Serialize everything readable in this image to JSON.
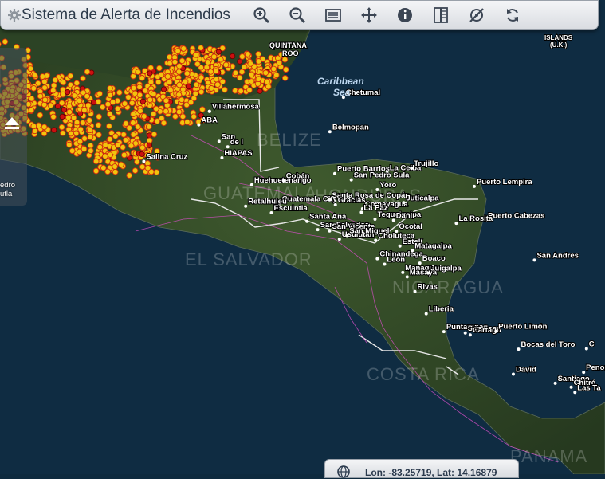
{
  "app": {
    "title": "Sistema de Alerta de Incendios"
  },
  "toolbar": {
    "buttons": [
      {
        "name": "zoom-in-button",
        "icon": "zoom-in-icon"
      },
      {
        "name": "zoom-out-button",
        "icon": "zoom-out-icon"
      },
      {
        "name": "layers-list-button",
        "icon": "list-icon"
      },
      {
        "name": "pan-button",
        "icon": "move-icon"
      },
      {
        "name": "info-button",
        "icon": "info-icon"
      },
      {
        "name": "swipe-button",
        "icon": "swipe-icon"
      },
      {
        "name": "measure-button",
        "icon": "measure-icon"
      },
      {
        "name": "refresh-button",
        "icon": "refresh-icon"
      }
    ]
  },
  "sidepanel": {
    "fragment_line1": "edro",
    "fragment_line2": "utla"
  },
  "coords": {
    "text": "Lon: -83.25719, Lat: 14.16879"
  },
  "map": {
    "sea_labels": [
      "Caribbean",
      "Sea"
    ],
    "country_labels": [
      "BELIZE",
      "HONDURAS",
      "EL SALVADOR",
      "NICARAGUA",
      "COSTA RICA",
      "PANAMA",
      "GUATEMALA"
    ],
    "top_labels": [
      "QUINTANA",
      "ROO",
      "ISLANDS",
      "(U.K.)"
    ],
    "cities": [
      {
        "name": "Chetumal",
        "lon": -88.3,
        "lat": 18.5
      },
      {
        "name": "Villahermosa",
        "lon": -92.93,
        "lat": 17.99
      },
      {
        "name": "Belmopan",
        "lon": -88.77,
        "lat": 17.25
      },
      {
        "name": "Salina Cruz",
        "lon": -95.2,
        "lat": 16.17
      },
      {
        "name": "Huehuetenango",
        "lon": -91.47,
        "lat": 15.32
      },
      {
        "name": "Cobán",
        "lon": -90.37,
        "lat": 15.47
      },
      {
        "name": "Guatemala City",
        "lon": -90.51,
        "lat": 14.63
      },
      {
        "name": "Retalhuleu",
        "lon": -91.68,
        "lat": 14.54
      },
      {
        "name": "Escuintla",
        "lon": -90.79,
        "lat": 14.3
      },
      {
        "name": "Puerto Barrios",
        "lon": -88.6,
        "lat": 15.73
      },
      {
        "name": "La Ceiba",
        "lon": -86.79,
        "lat": 15.76
      },
      {
        "name": "Trujillo",
        "lon": -85.95,
        "lat": 15.92
      },
      {
        "name": "San Pedro Sula",
        "lon": -88.03,
        "lat": 15.5
      },
      {
        "name": "Santa Rosa de Copán",
        "lon": -88.78,
        "lat": 14.77
      },
      {
        "name": "Yoro",
        "lon": -87.13,
        "lat": 15.14
      },
      {
        "name": "Gracias",
        "lon": -88.58,
        "lat": 14.59
      },
      {
        "name": "Comayagua",
        "lon": -87.64,
        "lat": 14.45
      },
      {
        "name": "Juticalpa",
        "lon": -86.22,
        "lat": 14.67
      },
      {
        "name": "Tegucigalpa",
        "lon": -87.21,
        "lat": 14.07
      },
      {
        "name": "La Paz",
        "lon": -87.68,
        "lat": 14.32
      },
      {
        "name": "Santa Ana",
        "lon": -89.56,
        "lat": 13.99
      },
      {
        "name": "San Salvador",
        "lon": -89.19,
        "lat": 13.69
      },
      {
        "name": "San Vicente",
        "lon": -88.78,
        "lat": 13.64
      },
      {
        "name": "Usulután",
        "lon": -88.44,
        "lat": 13.34
      },
      {
        "name": "San Miguel",
        "lon": -88.18,
        "lat": 13.48
      },
      {
        "name": "Danlí",
        "lon": -86.57,
        "lat": 14.03
      },
      {
        "name": "Ocotal",
        "lon": -86.47,
        "lat": 13.63
      },
      {
        "name": "Chinandega",
        "lon": -87.13,
        "lat": 12.63
      },
      {
        "name": "Choluteca",
        "lon": -87.19,
        "lat": 13.3
      },
      {
        "name": "Estelí",
        "lon": -86.35,
        "lat": 13.09
      },
      {
        "name": "Matagalpa",
        "lon": -85.92,
        "lat": 12.93
      },
      {
        "name": "León",
        "lon": -86.88,
        "lat": 12.43
      },
      {
        "name": "Boaco",
        "lon": -85.66,
        "lat": 12.47
      },
      {
        "name": "Managua",
        "lon": -86.25,
        "lat": 12.13
      },
      {
        "name": "Masaya",
        "lon": -86.1,
        "lat": 11.97
      },
      {
        "name": "Juigalpa",
        "lon": -85.37,
        "lat": 12.11
      },
      {
        "name": "Rivas",
        "lon": -85.83,
        "lat": 11.44
      },
      {
        "name": "Liberia",
        "lon": -85.44,
        "lat": 10.63
      },
      {
        "name": "Puntarenas",
        "lon": -84.83,
        "lat": 9.98
      },
      {
        "name": "San José",
        "lon": -84.09,
        "lat": 9.93
      },
      {
        "name": "Cartago",
        "lon": -83.92,
        "lat": 9.86
      },
      {
        "name": "Puerto Limón",
        "lon": -83.03,
        "lat": 9.99
      },
      {
        "name": "Bocas del Toro",
        "lon": -82.25,
        "lat": 9.34
      },
      {
        "name": "David",
        "lon": -82.43,
        "lat": 8.43
      },
      {
        "name": "Santiago",
        "lon": -80.98,
        "lat": 8.1
      },
      {
        "name": "Chitré",
        "lon": -80.43,
        "lat": 7.96
      },
      {
        "name": "Las Ta",
        "lon": -80.3,
        "lat": 7.77
      },
      {
        "name": "Penon",
        "lon": -80.0,
        "lat": 8.5
      },
      {
        "name": "C",
        "lon": -79.9,
        "lat": 9.36
      },
      {
        "name": "Puerto Lempira",
        "lon": -83.78,
        "lat": 15.26
      },
      {
        "name": "Puerto Cabezas",
        "lon": -83.39,
        "lat": 14.03
      },
      {
        "name": "La Rosita",
        "lon": -84.4,
        "lat": 13.92
      },
      {
        "name": "San Andres",
        "lon": -81.7,
        "lat": 12.58
      },
      {
        "name": "San",
        "lon": -92.6,
        "lat": 16.9
      },
      {
        "name": "de l",
        "lon": -92.3,
        "lat": 16.7
      },
      {
        "name": "HIAPAS",
        "lon": -92.5,
        "lat": 16.3
      },
      {
        "name": "ABA",
        "lon": -93.3,
        "lat": 17.5
      },
      {
        "name": "Villah",
        "lon": -92.93,
        "lat": 17.99
      }
    ],
    "fire_color": "#f2c40d",
    "fire_hot_color": "#cc1010"
  }
}
